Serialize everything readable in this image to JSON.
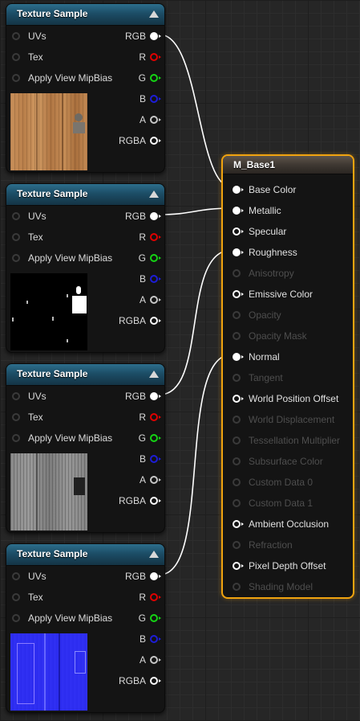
{
  "colors": {
    "accent_selected": "#f0a30f",
    "texture_header": "#1c4d66",
    "pin_red": "#e00000",
    "pin_green": "#14d414",
    "pin_blue": "#1d1dd8"
  },
  "texture_nodes": [
    {
      "title": "Texture Sample",
      "inputs": [
        "UVs",
        "Tex",
        "Apply View MipBias"
      ],
      "outputs": [
        "RGB",
        "R",
        "G",
        "B",
        "A",
        "RGBA"
      ],
      "preview": "wood-diffuse-preview"
    },
    {
      "title": "Texture Sample",
      "inputs": [
        "UVs",
        "Tex",
        "Apply View MipBias"
      ],
      "outputs": [
        "RGB",
        "R",
        "G",
        "B",
        "A",
        "RGBA"
      ],
      "preview": "metallic-mask-preview"
    },
    {
      "title": "Texture Sample",
      "inputs": [
        "UVs",
        "Tex",
        "Apply View MipBias"
      ],
      "outputs": [
        "RGB",
        "R",
        "G",
        "B",
        "A",
        "RGBA"
      ],
      "preview": "roughness-preview"
    },
    {
      "title": "Texture Sample",
      "inputs": [
        "UVs",
        "Tex",
        "Apply View MipBias"
      ],
      "outputs": [
        "RGB",
        "R",
        "G",
        "B",
        "A",
        "RGBA"
      ],
      "preview": "normal-map-preview"
    }
  ],
  "material_node": {
    "title": "M_Base1",
    "inputs": [
      {
        "label": "Base Color",
        "state": "connected"
      },
      {
        "label": "Metallic",
        "state": "connected"
      },
      {
        "label": "Specular",
        "state": "enabled"
      },
      {
        "label": "Roughness",
        "state": "connected"
      },
      {
        "label": "Anisotropy",
        "state": "disabled"
      },
      {
        "label": "Emissive Color",
        "state": "enabled"
      },
      {
        "label": "Opacity",
        "state": "disabled"
      },
      {
        "label": "Opacity Mask",
        "state": "disabled"
      },
      {
        "label": "Normal",
        "state": "connected"
      },
      {
        "label": "Tangent",
        "state": "disabled"
      },
      {
        "label": "World Position Offset",
        "state": "enabled"
      },
      {
        "label": "World Displacement",
        "state": "disabled"
      },
      {
        "label": "Tessellation Multiplier",
        "state": "disabled"
      },
      {
        "label": "Subsurface Color",
        "state": "disabled"
      },
      {
        "label": "Custom Data 0",
        "state": "disabled"
      },
      {
        "label": "Custom Data 1",
        "state": "disabled"
      },
      {
        "label": "Ambient Occlusion",
        "state": "enabled"
      },
      {
        "label": "Refraction",
        "state": "disabled"
      },
      {
        "label": "Pixel Depth Offset",
        "state": "enabled"
      },
      {
        "label": "Shading Model",
        "state": "disabled"
      }
    ]
  }
}
